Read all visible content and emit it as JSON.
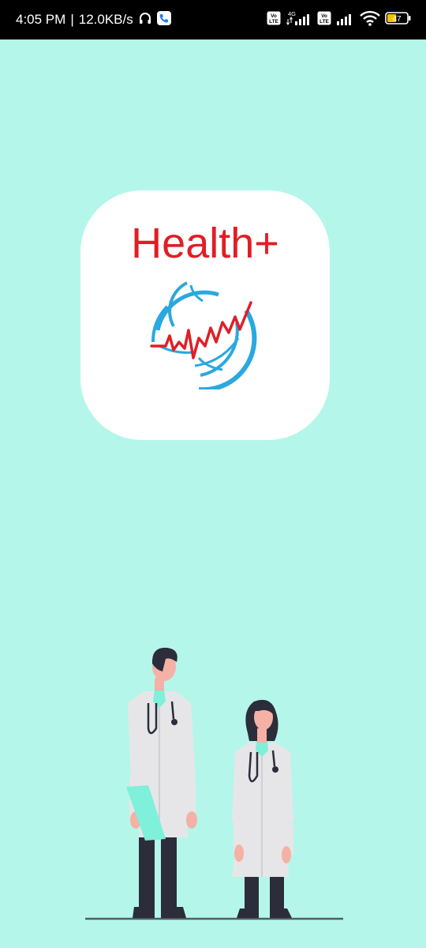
{
  "status_bar": {
    "time": "4:05 PM",
    "separator": "|",
    "network_speed": "12.0KB/s",
    "network_type": "4G",
    "volte_label": "Vo LTE",
    "battery_level": "47"
  },
  "splash": {
    "logo_title": "Health+"
  },
  "colors": {
    "background": "#b4f7ea",
    "logo_red": "#e01e26",
    "logo_blue": "#2aa8e0",
    "card": "#ffffff"
  }
}
